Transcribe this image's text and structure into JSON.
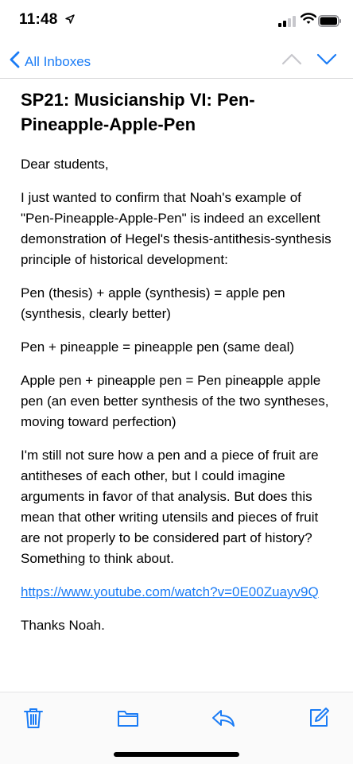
{
  "status_bar": {
    "time": "11:48"
  },
  "nav": {
    "back_label": "All Inboxes"
  },
  "email": {
    "subject": "SP21: Musicianship VI: Pen-Pineapple-Apple-Pen",
    "paragraphs": [
      "Dear students,",
      "I just wanted to confirm that Noah's example of \"Pen-Pineapple-Apple-Pen\" is indeed an excellent demonstration of Hegel's thesis-antithesis-synthesis principle of historical development:",
      "Pen (thesis) + apple (synthesis) = apple pen (synthesis, clearly better)",
      "Pen + pineapple = pineapple pen (same deal)",
      "Apple pen + pineapple pen = Pen pineapple apple pen (an even better synthesis of the two syntheses, moving toward perfection)",
      "I'm still not sure how a pen and a piece of fruit are antitheses of each other, but I could imagine arguments in favor of that analysis.  But does this mean that other writing utensils and pieces of fruit are not properly to be considered part of history?  Something to think about."
    ],
    "link": "https://www.youtube.com/watch?v=0E00Zuayv9Q",
    "signoff": "Thanks Noah."
  },
  "colors": {
    "accent": "#1b7cf5",
    "signal_inactive": "#c7c7cc"
  },
  "icons": [
    "location-arrow-icon",
    "signal-icon",
    "wifi-icon",
    "battery-icon",
    "chevron-left-icon",
    "chevron-up-icon",
    "chevron-down-icon",
    "trash-icon",
    "folder-icon",
    "reply-icon",
    "compose-icon"
  ]
}
